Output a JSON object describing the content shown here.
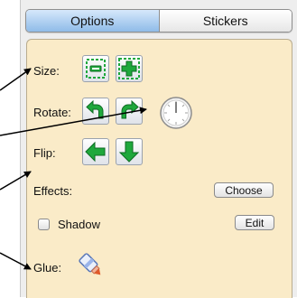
{
  "tabs": [
    {
      "label": "Options",
      "active": true
    },
    {
      "label": "Stickers",
      "active": false
    }
  ],
  "rows": {
    "size": "Size:",
    "rotate": "Rotate:",
    "flip": "Flip:",
    "effects": "Effects:",
    "glue": "Glue:"
  },
  "buttons": {
    "choose": "Choose",
    "edit": "Edit"
  },
  "shadow": {
    "label": "Shadow",
    "checked": false
  },
  "icons": {
    "size_smaller": "shrink-icon",
    "size_larger": "enlarge-icon",
    "rotate_left": "rotate-left-icon",
    "rotate_right": "rotate-right-icon",
    "rotate_dial": "rotation-dial-icon",
    "flip_horizontal": "flip-horizontal-icon",
    "flip_vertical": "flip-vertical-icon",
    "glue": "glue-stick-icon"
  },
  "colors": {
    "panel_bg": "#faebc8",
    "tab_active": "#8fbbe8",
    "icon_green": "#1fa83c"
  }
}
